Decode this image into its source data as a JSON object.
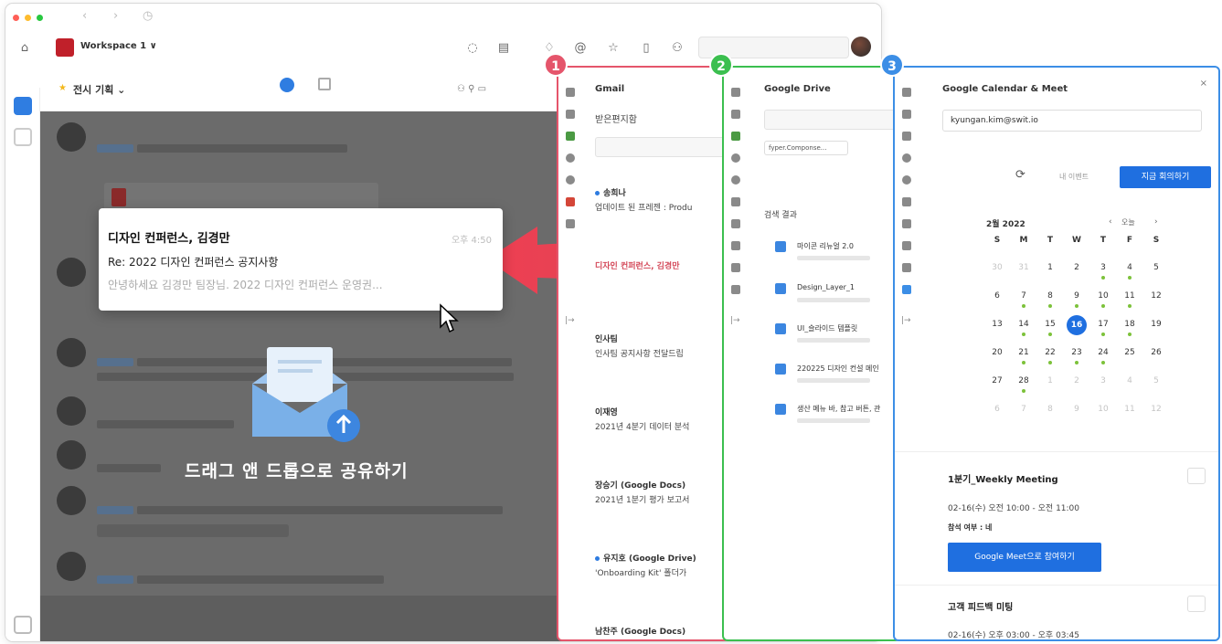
{
  "window": {
    "workspace_name": "Workspace 1 ∨",
    "channel_name": "전시 기획 ⌄"
  },
  "toast": {
    "title": "디자인 컨퍼런스, 김경만",
    "time": "오후 4:50",
    "subject": "Re: 2022 디자인 컨퍼런스 공지사항",
    "preview": "안녕하세요 김경만 팀장님. 2022 디자인 컨퍼런스 운영권..."
  },
  "drop_label": "드래그 앤 드롭으로 공유하기",
  "badges": [
    "1",
    "2",
    "3"
  ],
  "gmail": {
    "title": "Gmail",
    "folder": "받은편지함",
    "items": [
      {
        "from": "송희나",
        "subject": "업데이트 된 프레젠 : Produ",
        "unread": true
      },
      {
        "from": "디자인 컨퍼런스, 김경만",
        "subject": "",
        "unread": false
      },
      {
        "from": "인사팀",
        "subject": "인사팀 공지사항 전달드립",
        "unread": false
      },
      {
        "from": "이재영",
        "subject": "2021년 4분기 데이터 분석",
        "unread": false
      },
      {
        "from": "장승기 (Google Docs)",
        "subject": "2021년 1분기 평가 보고서",
        "unread": false
      },
      {
        "from": "유지호 (Google Drive)",
        "subject": "'Onboarding Kit' 폴더가",
        "unread": true
      },
      {
        "from": "남찬주 (Google Docs)",
        "subject": "",
        "unread": false
      }
    ]
  },
  "drive": {
    "title": "Google Drive",
    "filter_label": "fyper.Componse...",
    "results_label": "검색 결과",
    "files": [
      "마이콘 리뉴얼 2.0",
      "Design_Layer_1",
      "UI_슬라이드 템플릿",
      "220225 디자인 컨설 메인",
      "생산 메뉴 바, 참고 버튼, 관"
    ]
  },
  "calendar": {
    "title": "Google Calendar & Meet",
    "account": "kyungan.kim@swit.io",
    "btn_secondary": "내 이벤트",
    "btn_primary": "지금 회의하기",
    "month": "2월 2022",
    "today_label": "오늘",
    "weekdays": [
      "S",
      "M",
      "T",
      "W",
      "T",
      "F",
      "S"
    ],
    "weeks": [
      [
        "30",
        "31",
        "1",
        "2",
        "3",
        "4",
        "5"
      ],
      [
        "6",
        "7",
        "8",
        "9",
        "10",
        "11",
        "12"
      ],
      [
        "13",
        "14",
        "15",
        "16",
        "17",
        "18",
        "19"
      ],
      [
        "20",
        "21",
        "22",
        "23",
        "24",
        "25",
        "26"
      ],
      [
        "27",
        "28",
        "1",
        "2",
        "3",
        "4",
        "5"
      ],
      [
        "6",
        "7",
        "8",
        "9",
        "10",
        "11",
        "12"
      ]
    ],
    "selected_day": "16",
    "events": [
      {
        "title": "1분기_Weekly Meeting",
        "time": "02-16(수) 오전 10:00 - 오전 11:00",
        "attend": "참석 여부 : 네",
        "join": "Google Meet으로 참여하기"
      },
      {
        "title": "고객 피드백 미팅",
        "time": "02-16(수) 오후 03:00 - 오후 03:45"
      }
    ]
  },
  "colors": {
    "panel1": "#e5556b",
    "panel2": "#3bbf4f",
    "panel3": "#3c8ee6",
    "accent_blue": "#1f6fe0",
    "arrow_red": "#ef3f52"
  }
}
